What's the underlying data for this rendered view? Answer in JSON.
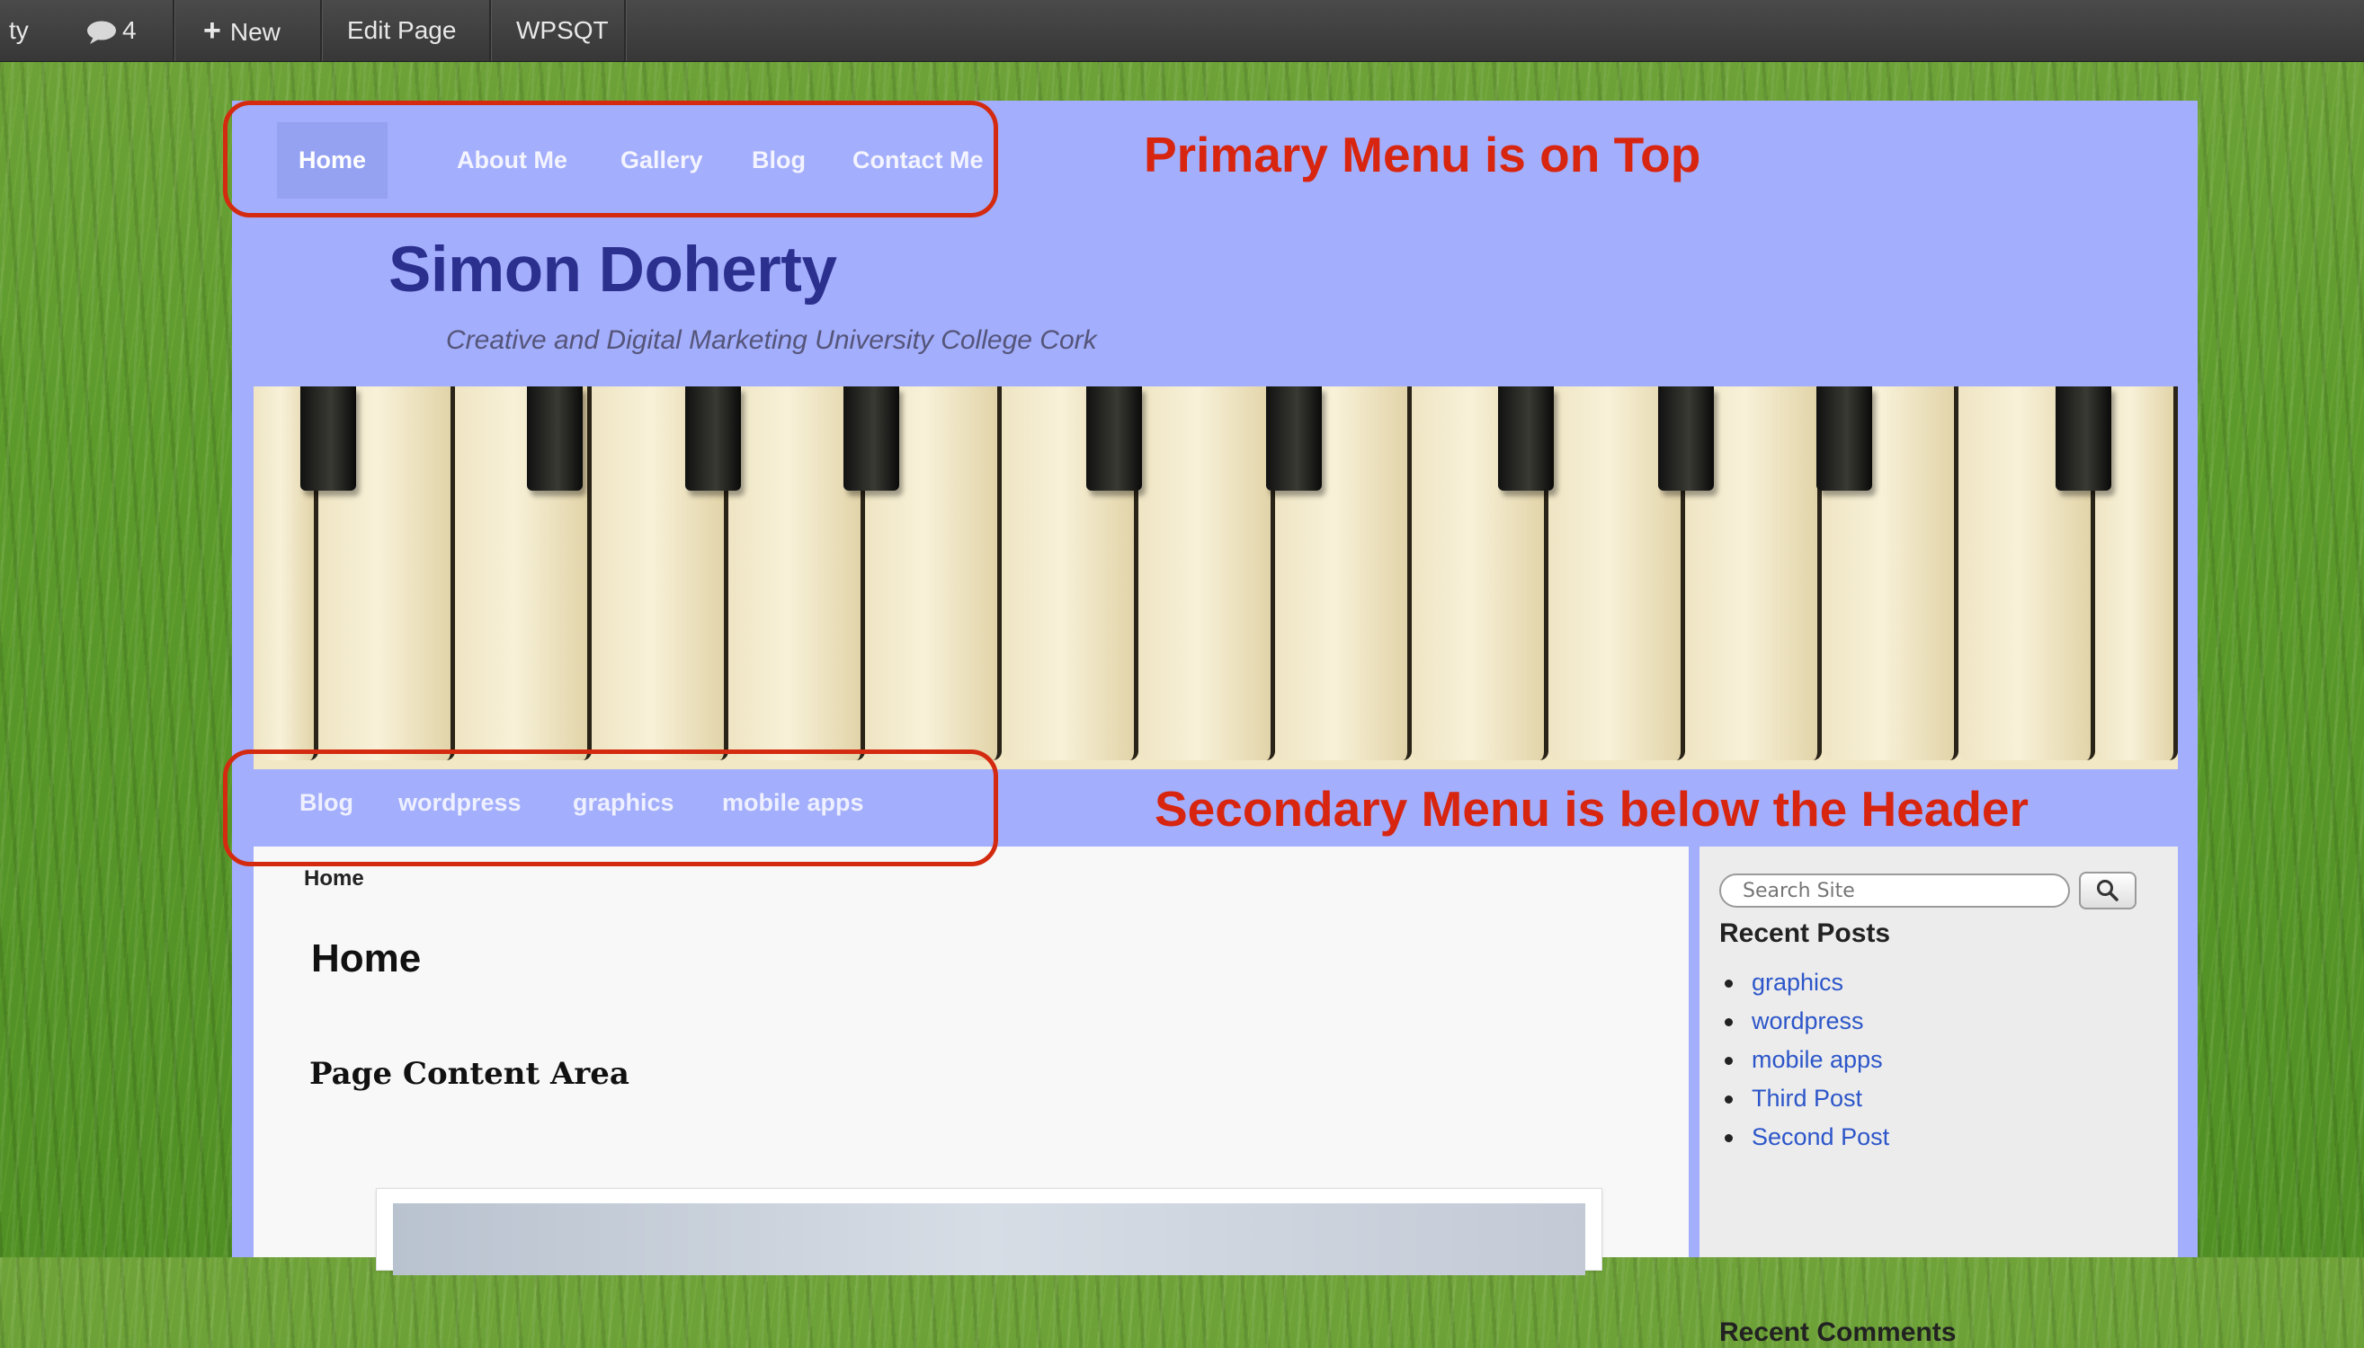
{
  "admin_bar": {
    "site_fragment": "ty",
    "comments_count": "4",
    "new_label": "New",
    "edit_page_label": "Edit Page",
    "plugin_label": "WPSQT"
  },
  "site": {
    "title": "Simon Doherty",
    "description": "Creative and Digital Marketing University College Cork"
  },
  "primary_menu": {
    "items": [
      "Home",
      "About Me",
      "Gallery",
      "Blog",
      "Contact Me"
    ]
  },
  "secondary_menu": {
    "items": [
      "Blog",
      "wordpress",
      "graphics",
      "mobile apps"
    ]
  },
  "content": {
    "breadcrumb": "Home",
    "page_title": "Home",
    "heading": "Page Content Area"
  },
  "sidebar": {
    "search_placeholder": "Search Site",
    "recent_posts_title": "Recent Posts",
    "recent_posts": [
      "graphics",
      "wordpress",
      "mobile apps",
      "Third Post",
      "Second Post"
    ],
    "recent_comments_title": "Recent Comments"
  },
  "annotations": {
    "primary": "Primary Menu is on Top",
    "secondary": "Secondary Menu is below the Header",
    "color": "#d32a10"
  },
  "colors": {
    "wrapper_bg": "#a3aefc",
    "site_title": "#2b2f8e",
    "link": "#2c56c9",
    "admin_bar": "#3f3f3f"
  }
}
